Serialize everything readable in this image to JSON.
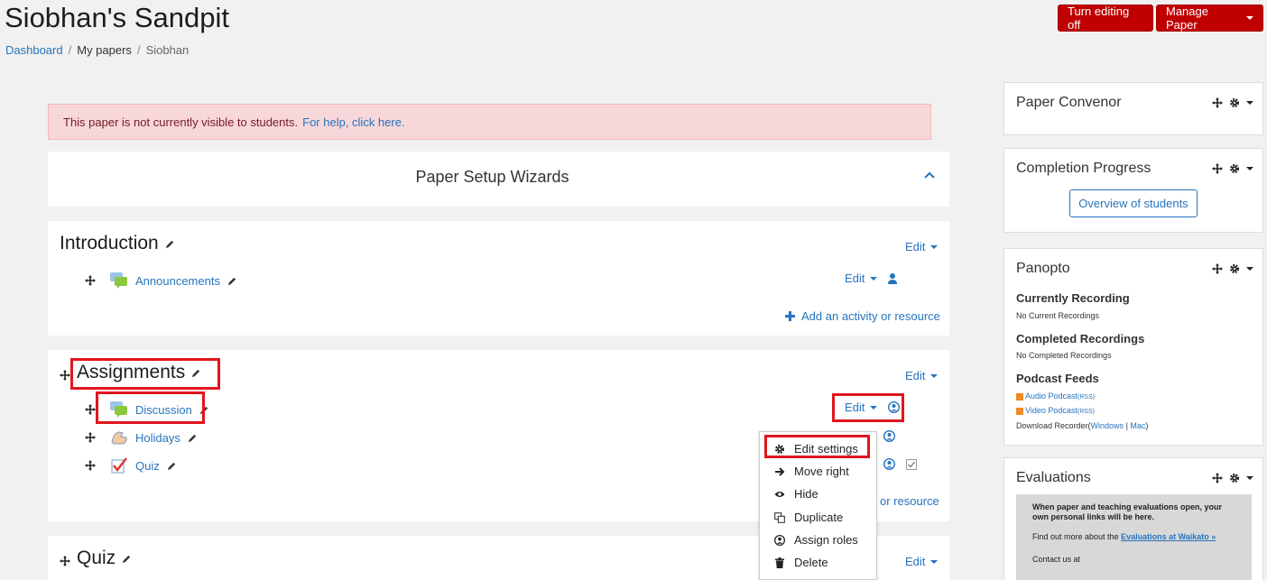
{
  "header": {
    "title": "Siobhan's Sandpit",
    "breadcrumb": [
      "Dashboard",
      "My papers",
      "Siobhan"
    ],
    "turn_editing_off": "Turn editing off",
    "manage_paper": "Manage Paper"
  },
  "alert": {
    "text": "This paper is not currently visible to students.",
    "link": "For help, click here."
  },
  "wizard": {
    "title": "Paper Setup Wizards"
  },
  "sections": {
    "introduction": {
      "title": "Introduction",
      "edit": "Edit",
      "activities": [
        {
          "name": "Announcements",
          "edit": "Edit"
        }
      ],
      "add": "Add an activity or resource"
    },
    "assignments": {
      "title": "Assignments",
      "edit": "Edit",
      "activities": [
        {
          "name": "Discussion",
          "edit": "Edit"
        },
        {
          "name": "Holidays"
        },
        {
          "name": "Quiz"
        }
      ],
      "add_partial": "or resource"
    },
    "quiz": {
      "title": "Quiz",
      "edit": "Edit"
    }
  },
  "dropdown": [
    "Edit settings",
    "Move right",
    "Hide",
    "Duplicate",
    "Assign roles",
    "Delete"
  ],
  "sidebar": {
    "convenor": {
      "title": "Paper Convenor"
    },
    "completion": {
      "title": "Completion Progress",
      "button": "Overview of students"
    },
    "panopto": {
      "title": "Panopto",
      "current_h": "Currently Recording",
      "current_s": "No Current Recordings",
      "completed_h": "Completed Recordings",
      "completed_s": "No Completed Recordings",
      "podcast_h": "Podcast Feeds",
      "audio": "Audio Podcast",
      "video": "Video Podcast",
      "rss": "(RSS)",
      "download": "Download Recorder",
      "windows": "Windows",
      "mac": "Mac"
    },
    "evaluations": {
      "title": "Evaluations",
      "p1": "When paper and teaching evaluations open, your own personal links will be here.",
      "p2": "Find out more about the",
      "p2_link": "Evaluations at Waikato »",
      "p3": "Contact us at"
    }
  },
  "colors": {
    "accent": "#c00000",
    "link": "#2674be",
    "highlight": "#e0161e"
  }
}
